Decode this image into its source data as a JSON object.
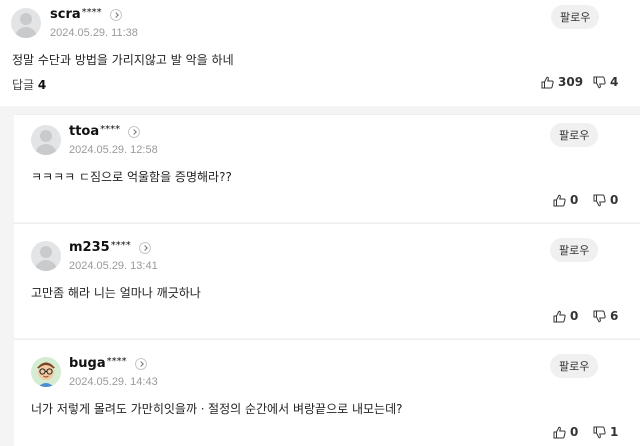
{
  "comments": [
    {
      "nick": "scra",
      "stars": "****",
      "date": "2024.05.29. 11:38",
      "follow_label": "팔로우",
      "content": "정말 수단과 방법을 가리지않고 발 악을 하네",
      "reply_label": "답글",
      "reply_count": "4",
      "likes": "309",
      "dislikes": "4"
    }
  ],
  "replies": [
    {
      "nick": "ttoa",
      "stars": "****",
      "date": "2024.05.29. 12:58",
      "follow_label": "팔로우",
      "content": "ㅋㅋㅋㅋ ㄷ짐으로 억울함을 증명해라??",
      "likes": "0",
      "dislikes": "0",
      "avatar": "default"
    },
    {
      "nick": "m235",
      "stars": "****",
      "date": "2024.05.29. 13:41",
      "follow_label": "팔로우",
      "content": "고만좀 해라 니는 얼마나 깨긋하나",
      "likes": "0",
      "dislikes": "6",
      "avatar": "default"
    },
    {
      "nick": "buga",
      "stars": "****",
      "date": "2024.05.29. 14:43",
      "follow_label": "팔로우",
      "content": "너가 저렇게 몰려도 가만히잇을까ㆍ절정의 순간에서 벼랑끝으로 내모는데?",
      "likes": "0",
      "dislikes": "1",
      "avatar": "character"
    }
  ]
}
